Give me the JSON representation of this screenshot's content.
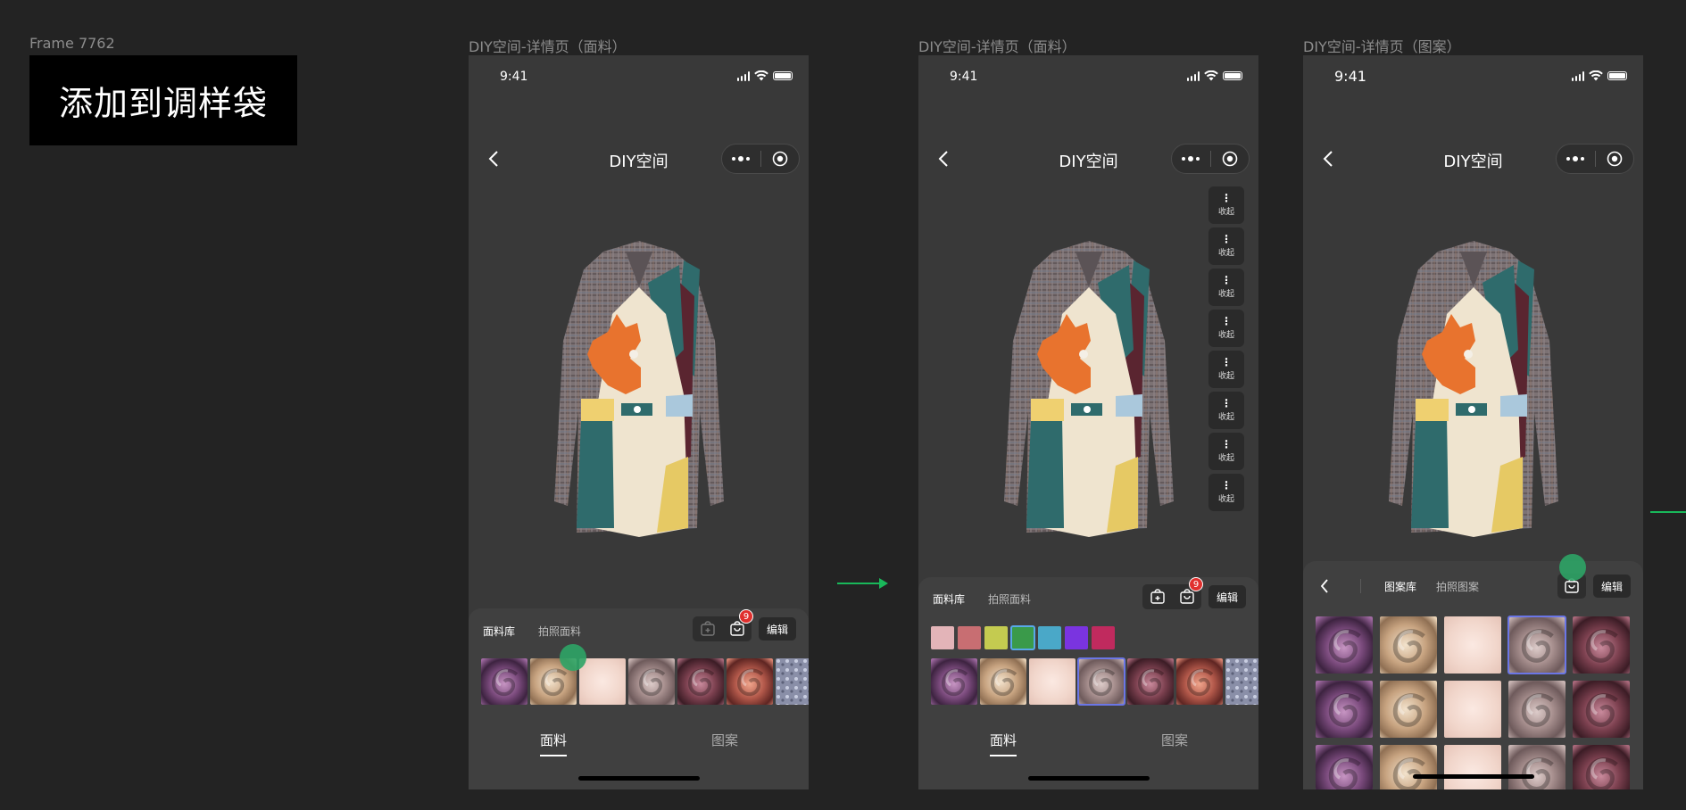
{
  "frame": {
    "label": "Frame 7762",
    "banner_text": "添加到调样袋"
  },
  "screens": [
    {
      "label": "DIY空间-详情页（面料）",
      "time": "9:41",
      "title": "DIY空间",
      "tabs": [
        "面料库",
        "拍照面料"
      ],
      "badge": "9",
      "edit": "编辑",
      "bottom_tabs": [
        "面料",
        "图案"
      ]
    },
    {
      "label": "DIY空间-详情页（面料）",
      "time": "9:41",
      "title": "DIY空间",
      "tabs": [
        "面料库",
        "拍照面料"
      ],
      "badge": "9",
      "edit": "编辑",
      "bottom_tabs": [
        "面料",
        "图案"
      ],
      "collapse_label": "收起",
      "color_chips": [
        "#e3b4b8",
        "#c86e72",
        "#c4cb50",
        "#3a9a4a",
        "#4aa8c8",
        "#7a34e0",
        "#c02a5e"
      ]
    },
    {
      "label": "DIY空间-详情页（图案）",
      "time": "9:41",
      "title": "DIY空间",
      "tabs": [
        "图案库",
        "拍照图案"
      ],
      "edit": "编辑"
    }
  ],
  "icons": {
    "back": "chevron-left-icon",
    "more": "more-dots-icon",
    "record": "target-icon",
    "add_bag": "bag-plus-icon",
    "bag": "bag-icon",
    "collapse": "vertical-dots-icon"
  },
  "colors": {
    "accent": "#19b85a",
    "badge": "#e0302e",
    "selected": "#6b76e6"
  }
}
